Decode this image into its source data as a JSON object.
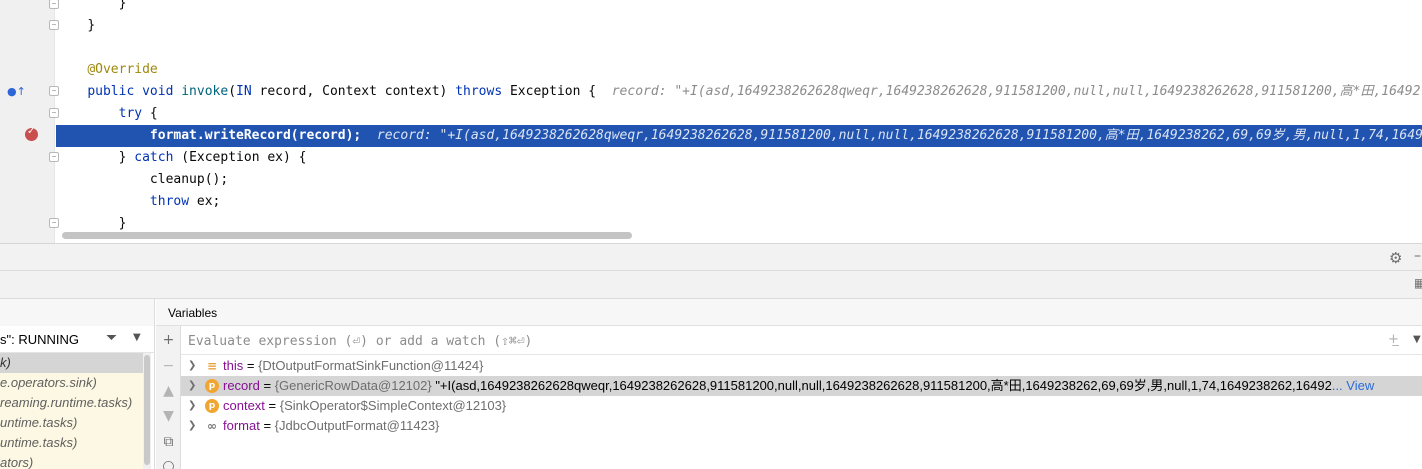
{
  "editor": {
    "lines": [
      {
        "indent": "        ",
        "text": "}"
      },
      {
        "indent": "    ",
        "text": "}"
      },
      {
        "indent": "",
        "text": ""
      },
      {
        "indent": "    ",
        "annotation": "@Override"
      },
      {
        "indent": "    ",
        "kw1": "public void",
        "fn": "invoke",
        "args_a": "(",
        "kw2": "IN",
        "args_b": " record, Context context) ",
        "kw3": "throws",
        "rest": " Exception {",
        "hint": "record: \"+I(asd,1649238262628qweqr,1649238262628,911581200,null,null,1649238262628,911581200,高*田,16492"
      },
      {
        "indent": "        ",
        "kw": "try",
        "rest": " {"
      },
      {
        "indent": "            ",
        "stmt": "format.writeRecord(record);",
        "hint": "record: \"+I(asd,1649238262628qweqr,1649238262628,911581200,null,null,1649238262628,911581200,高*田,1649238262,69,69岁,男,null,1,74,1649"
      },
      {
        "indent": "        ",
        "pre": "} ",
        "kw": "catch",
        "rest": " (Exception ex) {"
      },
      {
        "indent": "            ",
        "text": "cleanup();"
      },
      {
        "indent": "            ",
        "kw": "throw",
        "rest": " ex;"
      },
      {
        "indent": "        ",
        "text": "}"
      }
    ]
  },
  "frames": {
    "thread_label": "s\": RUNNING",
    "items": [
      "k)",
      "e.operators.sink)",
      "reaming.runtime.tasks)",
      "untime.tasks)",
      "untime.tasks)",
      "ators)"
    ]
  },
  "variables": {
    "title": "Variables",
    "eval_placeholder": "Evaluate expression (⏎) or add a watch (⇧⌘⏎)",
    "rows": [
      {
        "name": "this",
        "eq": " = ",
        "type": "{DtOutputFormatSinkFunction@11424}",
        "value": "",
        "link": "",
        "icon": "≡"
      },
      {
        "name": "record",
        "eq": " = ",
        "type": "{GenericRowData@12102}",
        "value": " \"+I(asd,1649238262628qweqr,1649238262628,911581200,null,null,1649238262628,911581200,高*田,1649238262,69,69岁,男,null,1,74,1649238262,16492",
        "link": "... View",
        "icon": "p"
      },
      {
        "name": "context",
        "eq": " = ",
        "type": "{SinkOperator$SimpleContext@12103}",
        "value": "",
        "link": "",
        "icon": "p"
      },
      {
        "name": "format",
        "eq": " = ",
        "type": "{JdbcOutputFormat@11423}",
        "value": "",
        "link": "",
        "icon": "∞"
      }
    ]
  },
  "colors": {
    "selection": "#2154b0",
    "keyword": "#0033b3",
    "annotation": "#9e880d",
    "var_name": "#871094",
    "frame_bg": "#fcf8e3"
  },
  "icons": {
    "override": "override-gutter-icon",
    "breakpoint": "breakpoint-icon",
    "gear": "gear-icon",
    "filter": "filter-icon",
    "add": "plus-icon",
    "remove": "minus-icon",
    "up": "arrow-up-icon",
    "down": "arrow-down-icon",
    "copy": "copy-icon"
  }
}
